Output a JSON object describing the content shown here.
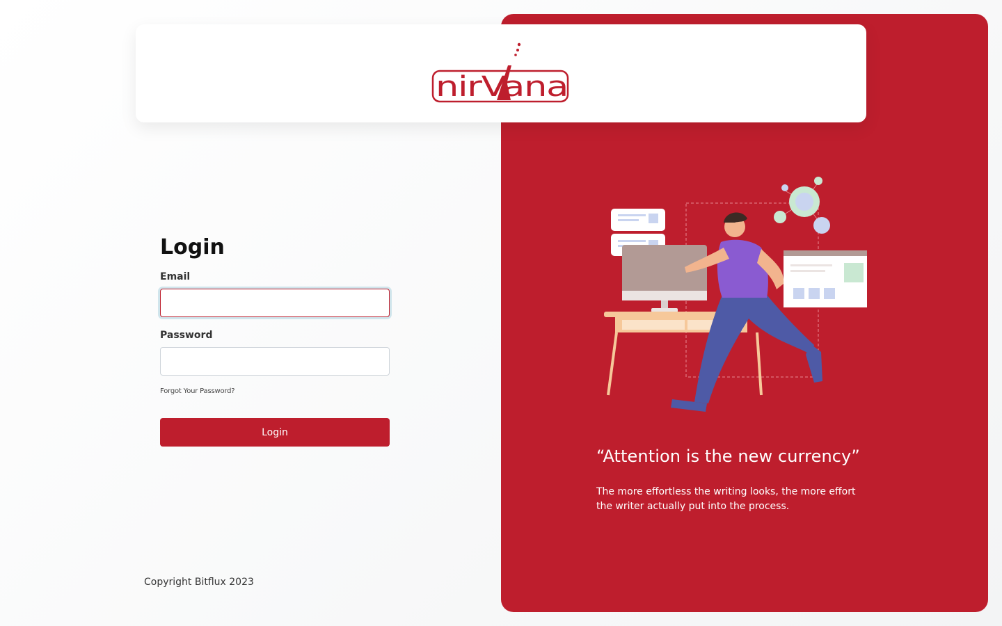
{
  "brand": {
    "logo_text": "nirVana",
    "color": "#be1e2d"
  },
  "login": {
    "title": "Login",
    "email_label": "Email",
    "email_value": "",
    "password_label": "Password",
    "password_value": "",
    "forgot_link": "Forgot Your Password?",
    "submit_label": "Login"
  },
  "footer": {
    "copyright": "Copyright Bitflux 2023"
  },
  "promo": {
    "quote_title": "“Attention is the new currency”",
    "quote_text": "The more effortless the writing looks, the more effort the writer actually put into the process.",
    "illustration": "person-running-to-computer-illustration"
  }
}
